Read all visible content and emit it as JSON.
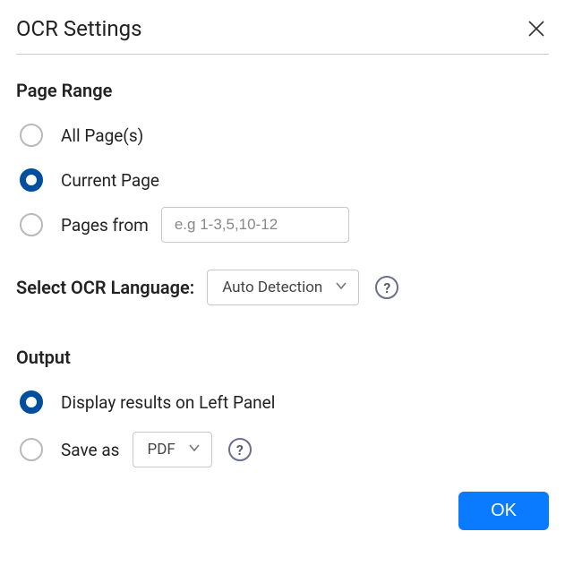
{
  "header": {
    "title": "OCR Settings"
  },
  "pageRange": {
    "heading": "Page Range",
    "options": {
      "all": {
        "label": "All Page(s)",
        "checked": false
      },
      "current": {
        "label": "Current Page",
        "checked": true
      },
      "pagesFrom": {
        "label": "Pages from",
        "checked": false,
        "placeholder": "e.g 1-3,5,10-12",
        "value": ""
      }
    }
  },
  "language": {
    "label": "Select OCR Language:",
    "selected": "Auto Detection"
  },
  "output": {
    "heading": "Output",
    "options": {
      "display": {
        "label": "Display results on Left Panel",
        "checked": true
      },
      "saveAs": {
        "label": "Save as",
        "checked": false,
        "format": "PDF"
      }
    }
  },
  "footer": {
    "ok": "OK"
  },
  "help": "?"
}
